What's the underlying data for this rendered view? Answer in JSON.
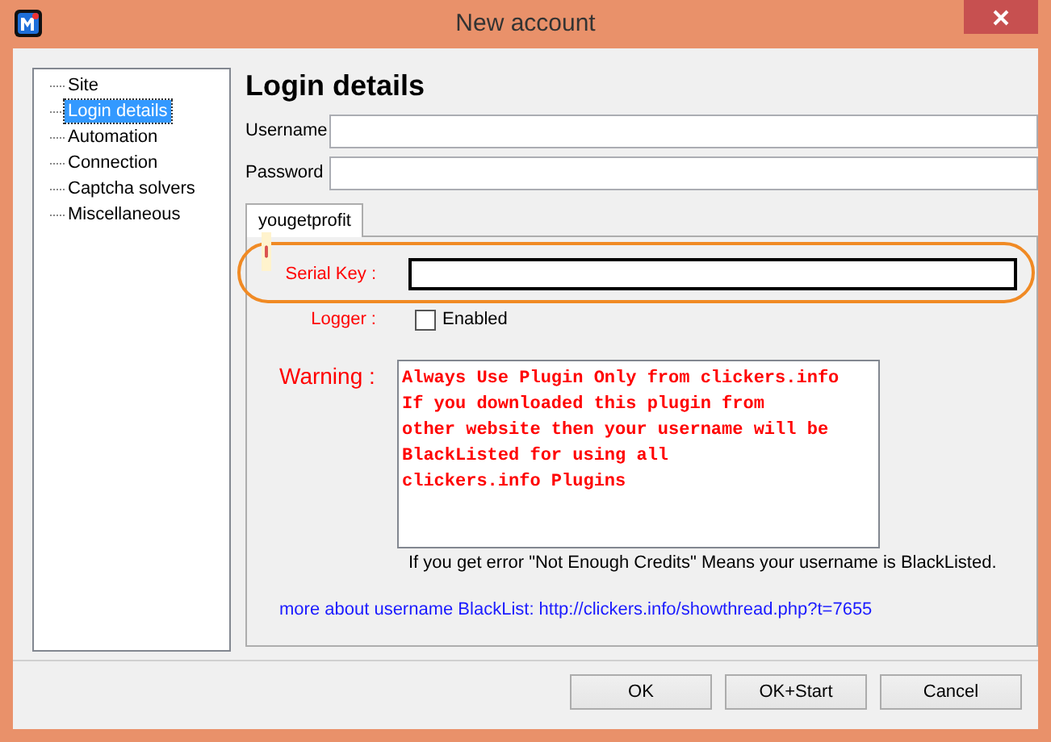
{
  "window": {
    "title": "New account"
  },
  "sidebar": {
    "items": [
      {
        "label": "Site",
        "selected": false
      },
      {
        "label": "Login details",
        "selected": true
      },
      {
        "label": "Automation",
        "selected": false
      },
      {
        "label": "Connection",
        "selected": false
      },
      {
        "label": "Captcha solvers",
        "selected": false
      },
      {
        "label": "Miscellaneous",
        "selected": false
      }
    ]
  },
  "heading": "Login details",
  "fields": [
    {
      "label": "Username"
    },
    {
      "label": "Password"
    }
  ],
  "tabs": [
    {
      "label": "yougetprofit",
      "selected": true
    }
  ],
  "plugin": {
    "serial_label": "Serial Key :",
    "logger_label": "Logger :",
    "logger_checkbox": {
      "label": "Enabled",
      "checked": false
    },
    "warning_label": "Warning :",
    "warning_lines": [
      "Always Use Plugin Only from clickers.info",
      "If you downloaded this plugin from",
      "other website then your username will be",
      "BlackListed for using all",
      "clickers.info Plugins"
    ],
    "note": "If you get error \"Not Enough Credits\" Means your username is BlackListed.",
    "link": "more about username BlackList: http://clickers.info/showthread.php?t=7655"
  },
  "buttons": [
    "OK",
    "OK+Start",
    "Cancel"
  ]
}
